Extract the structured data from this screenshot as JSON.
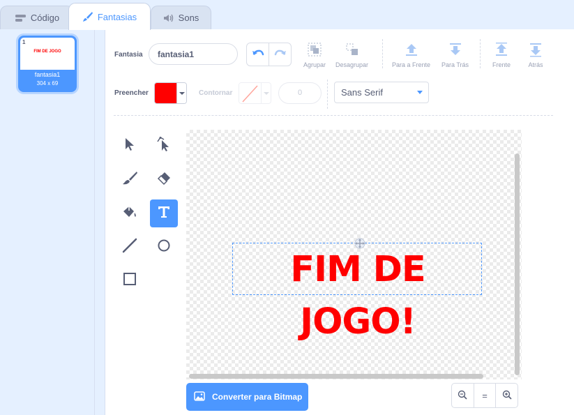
{
  "tabs": [
    {
      "label": "Código",
      "icon": "code-icon"
    },
    {
      "label": "Fantasias",
      "icon": "brush-icon"
    },
    {
      "label": "Sons",
      "icon": "speaker-icon"
    }
  ],
  "sidebar": {
    "costume": {
      "number": "1",
      "name": "fantasia1",
      "size": "304 x 69",
      "thumbnail_text": "FIM DE JOGO"
    }
  },
  "toolbar": {
    "costume_label": "Fantasia",
    "costume_name": "fantasia1",
    "group_label": "Agrupar",
    "ungroup_label": "Desagrupar",
    "forward_label": "Para a Frente",
    "backward_label": "Para Trás",
    "front_label": "Frente",
    "back_label": "Atrás",
    "fill_label": "Preencher",
    "fill_color": "#ff0000",
    "outline_label": "Contornar",
    "outline_width": "0",
    "font": "Sans Serif"
  },
  "canvas": {
    "text": "FIM DE JOGO!",
    "text_color": "#ff0000"
  },
  "bottom": {
    "bitmap_button": "Converter para Bitmap",
    "zoom_reset": "="
  },
  "colors": {
    "accent": "#4c97ff",
    "text": "#575e75"
  }
}
